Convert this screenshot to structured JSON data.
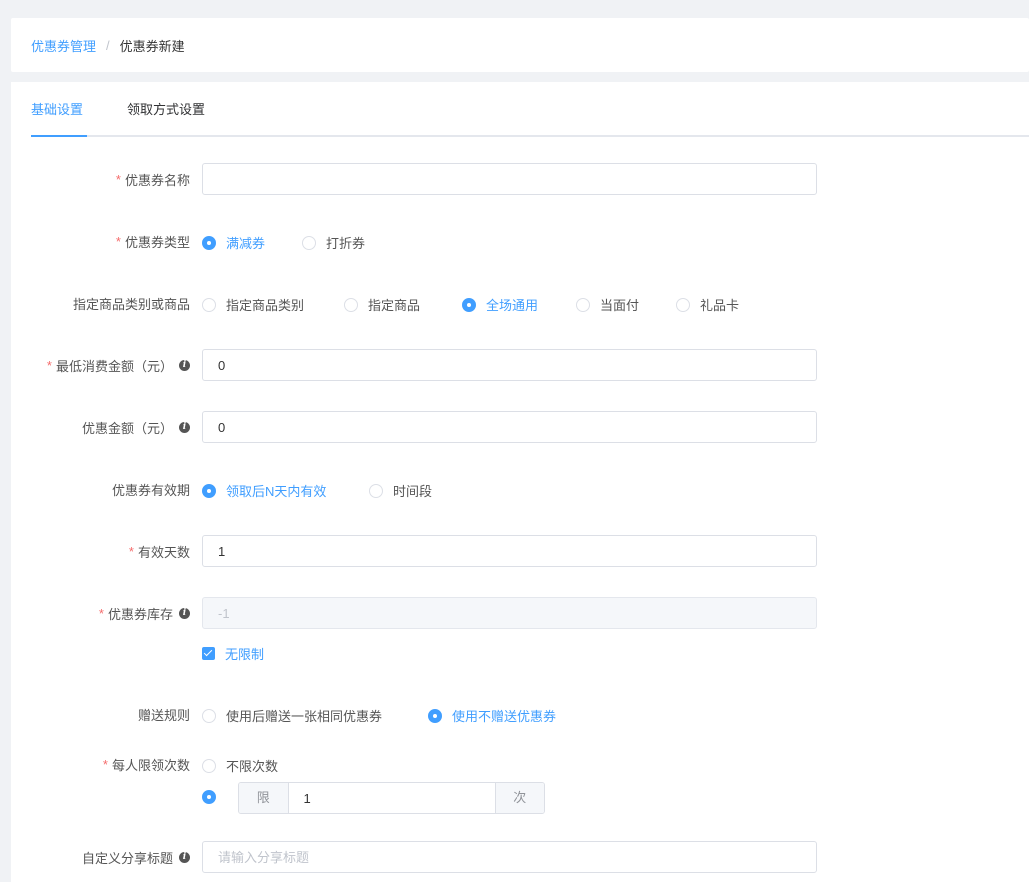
{
  "breadcrumb": {
    "parent": "优惠券管理",
    "separator": "/",
    "current": "优惠券新建"
  },
  "tabs": [
    {
      "label": "基础设置",
      "active": true
    },
    {
      "label": "领取方式设置",
      "active": false
    }
  ],
  "form": {
    "name": {
      "label": "优惠券名称",
      "required": true,
      "value": ""
    },
    "type": {
      "label": "优惠券类型",
      "required": true,
      "options": [
        {
          "label": "满减券",
          "checked": true
        },
        {
          "label": "打折券",
          "checked": false
        }
      ]
    },
    "scope": {
      "label": "指定商品类别或商品",
      "required": false,
      "options": [
        {
          "label": "指定商品类别",
          "checked": false
        },
        {
          "label": "指定商品",
          "checked": false
        },
        {
          "label": "全场通用",
          "checked": true
        },
        {
          "label": "当面付",
          "checked": false
        },
        {
          "label": "礼品卡",
          "checked": false
        }
      ]
    },
    "min_amount": {
      "label": "最低消费金额（元）",
      "required": true,
      "value": "0",
      "icon": "info-icon"
    },
    "discount_amount": {
      "label": "优惠金额（元）",
      "required": false,
      "value": "0",
      "icon": "info-icon"
    },
    "validity": {
      "label": "优惠券有效期",
      "required": false,
      "options": [
        {
          "label": "领取后N天内有效",
          "checked": true
        },
        {
          "label": "时间段",
          "checked": false
        }
      ]
    },
    "valid_days": {
      "label": "有效天数",
      "required": true,
      "value": "1"
    },
    "stock": {
      "label": "优惠券库存",
      "required": true,
      "value": "-1",
      "disabled": true,
      "icon": "info-icon"
    },
    "unlimited": {
      "label": "无限制",
      "checked": true
    },
    "gift_rule": {
      "label": "赠送规则",
      "required": false,
      "options": [
        {
          "label": "使用后赠送一张相同优惠券",
          "checked": false
        },
        {
          "label": "使用不赠送优惠券",
          "checked": true
        }
      ]
    },
    "per_user_limit": {
      "label": "每人限领次数",
      "required": true,
      "option_unlimited": {
        "label": "不限次数",
        "checked": false
      },
      "option_limited": {
        "checked": true,
        "prefix": "限",
        "value": "1",
        "suffix": "次"
      }
    },
    "share_title": {
      "label": "自定义分享标题",
      "required": false,
      "value": "",
      "placeholder": "请输入分享标题",
      "icon": "info-icon"
    }
  },
  "colors": {
    "accent": "#409eff",
    "required": "#f56c6c",
    "background": "#f0f2f5"
  }
}
